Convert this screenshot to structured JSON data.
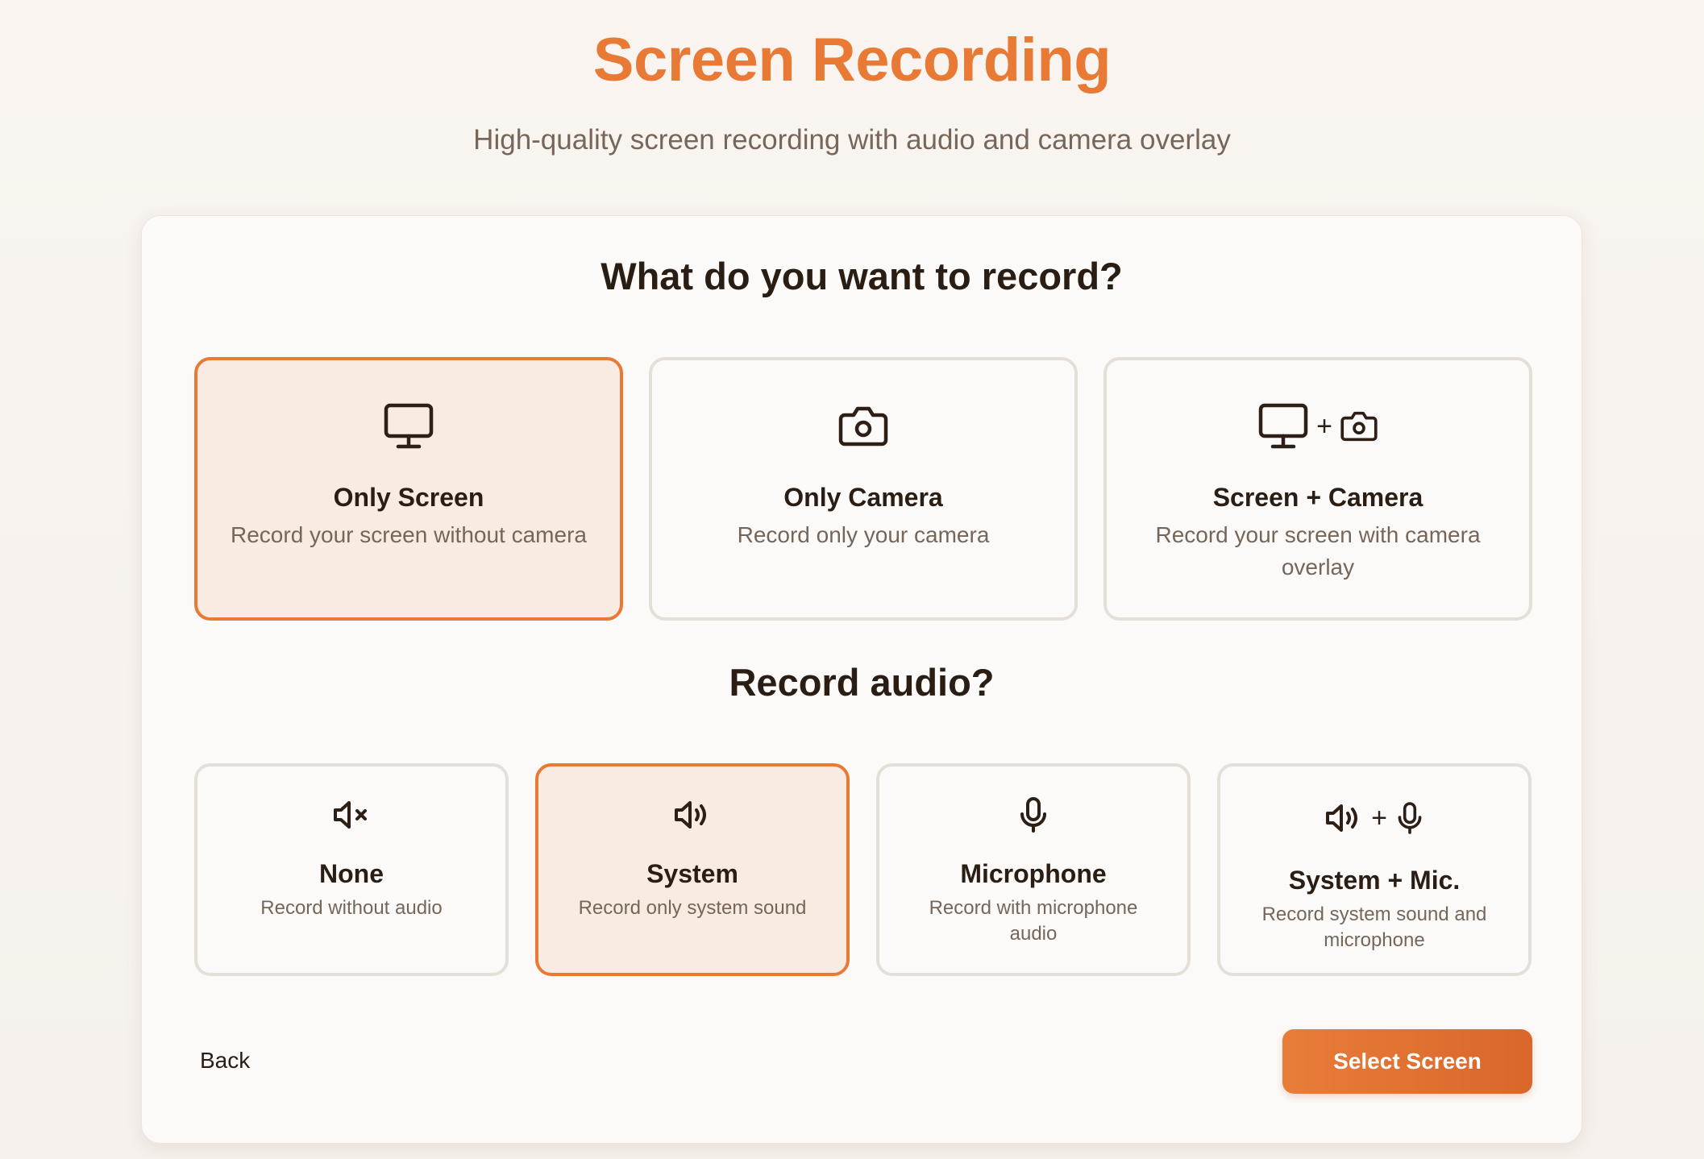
{
  "header": {
    "title": "Screen Recording",
    "subtitle": "High-quality screen recording with audio and camera overlay"
  },
  "record_section": {
    "heading": "What do you want to record?",
    "options": [
      {
        "title": "Only Screen",
        "description": "Record your screen without camera",
        "icon": "monitor-icon",
        "selected": true
      },
      {
        "title": "Only Camera",
        "description": "Record only your camera",
        "icon": "camera-icon",
        "selected": false
      },
      {
        "title": "Screen + Camera",
        "description": "Record your screen with camera overlay",
        "icon": "monitor-plus-camera-icon",
        "selected": false
      }
    ]
  },
  "audio_section": {
    "heading": "Record audio?",
    "options": [
      {
        "title": "None",
        "description": "Record without audio",
        "icon": "speaker-muted-icon",
        "selected": false
      },
      {
        "title": "System",
        "description": "Record only system sound",
        "icon": "speaker-icon",
        "selected": true
      },
      {
        "title": "Microphone",
        "description": "Record with microphone audio",
        "icon": "microphone-icon",
        "selected": false
      },
      {
        "title": "System + Mic.",
        "description": "Record system sound and microphone",
        "icon": "speaker-plus-microphone-icon",
        "selected": false
      }
    ]
  },
  "plus_symbol": "+",
  "footer": {
    "back_label": "Back",
    "primary_label": "Select Screen"
  },
  "colors": {
    "accent": "#e87a35",
    "selected_background": "#f9ebe2",
    "card_border": "#e5dfd9",
    "heading_text": "#2a1d14",
    "muted_text": "#76665a"
  }
}
